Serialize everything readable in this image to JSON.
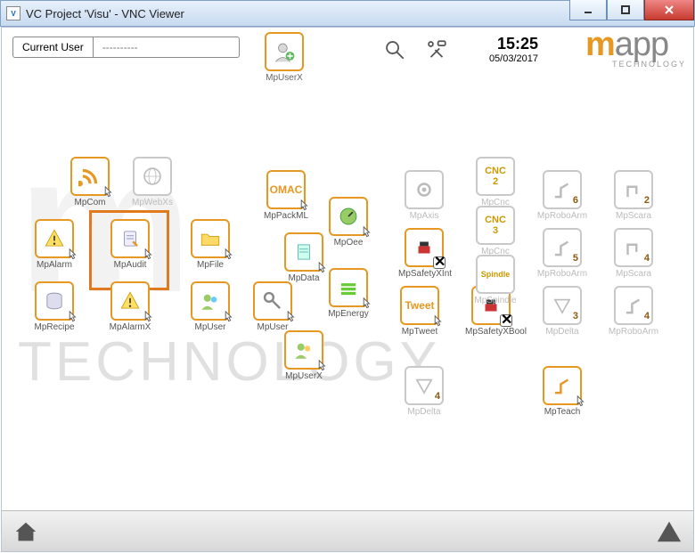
{
  "window": {
    "title": "VC Project 'Visu' - VNC Viewer"
  },
  "header": {
    "current_user_label": "Current User",
    "current_user_value": "----------",
    "user_add_label": "MpUserX",
    "time": "15:25",
    "date": "05/03/2017",
    "logo_m": "m",
    "logo_app": "app",
    "logo_sub": "TECHNOLOGY"
  },
  "watermark": "TECHNOLOGY",
  "icons": {
    "mpcom": "MpCom",
    "mpwebxs": "MpWebXs",
    "mpalarm": "MpAlarm",
    "mpaudit": "MpAudit",
    "mpfile": "MpFile",
    "mprecipe": "MpRecipe",
    "mpalarmx": "MpAlarmX",
    "mpuser": "MpUser",
    "mppackml": "MpPackML",
    "mpoee": "MpOee",
    "mpdata": "MpData",
    "mpuser2": "MpUser",
    "mpenergy": "MpEnergy",
    "mpuserx2": "MpUserX",
    "mpaxis": "MpAxis",
    "mpsafetyxint": "MpSafetyXInt",
    "mptweet": "MpTweet",
    "mpsafetyxbool": "MpSafetyXBool",
    "mpcnc2": "MpCnc",
    "mpcnc3": "MpCnc",
    "mpspindle": "MpSpindle",
    "mpdelta_dim": "MpDelta",
    "mproboarm6": "MpRoboArm",
    "mproboarm5": "MpRoboArm",
    "mpdelta3": "MpDelta",
    "mpteach": "MpTeach",
    "mpscara2": "MpScara",
    "mpscara4": "MpScara",
    "mproboarm4": "MpRoboArm"
  },
  "badges": {
    "cnc2": "CNC",
    "cnc2n": "2",
    "cnc3": "CNC",
    "cnc3n": "3",
    "spindle": "Spindle",
    "tweet": "Tweet",
    "omac": "OMAC"
  }
}
